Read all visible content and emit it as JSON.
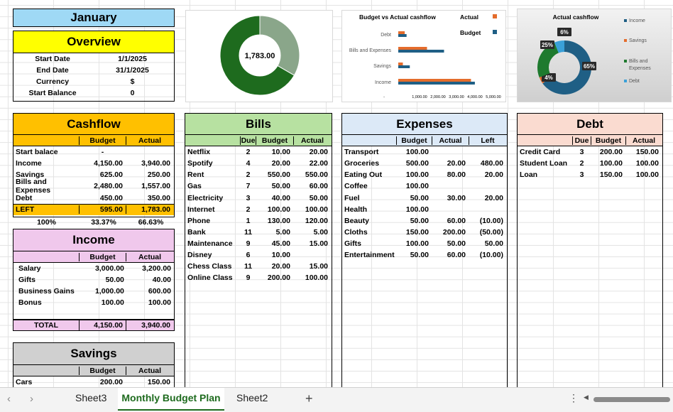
{
  "month": "January",
  "overview": {
    "title": "Overview",
    "rows": [
      [
        "Start Date",
        "1/1/2025"
      ],
      [
        "End Date",
        "31/1/2025"
      ],
      [
        "Currency",
        "$"
      ],
      [
        "Start Balance",
        "0"
      ]
    ]
  },
  "cashflow": {
    "title": "Cashflow",
    "budget": "Budget",
    "actual": "Actual",
    "rows": [
      [
        "Start balace",
        "-",
        ""
      ],
      [
        "Income",
        "4,150.00",
        "3,940.00"
      ],
      [
        "Savings",
        "625.00",
        "250.00"
      ],
      [
        "Bills and Expenses",
        "2,480.00",
        "1,557.00"
      ],
      [
        "Debt",
        "450.00",
        "350.00"
      ]
    ],
    "left": [
      "LEFT",
      "595.00",
      "1,783.00"
    ],
    "pct": [
      "100%",
      "33.37%",
      "66.63%"
    ]
  },
  "income": {
    "title": "Income",
    "budget": "Budget",
    "actual": "Actual",
    "rows": [
      [
        "Salary",
        "3,000.00",
        "3,200.00"
      ],
      [
        "Gifts",
        "50.00",
        "40.00"
      ],
      [
        "Business Gains",
        "1,000.00",
        "600.00"
      ],
      [
        "Bonus",
        "100.00",
        "100.00"
      ]
    ],
    "total": [
      "TOTAL",
      "4,150.00",
      "3,940.00"
    ]
  },
  "savings": {
    "title": "Savings",
    "budget": "Budget",
    "actual": "Actual",
    "rows": [
      [
        "Cars",
        "200.00",
        "150.00"
      ]
    ]
  },
  "bills": {
    "title": "Bills",
    "due": "Due",
    "budget": "Budget",
    "actual": "Actual",
    "rows": [
      [
        "Netflix",
        "2",
        "10.00",
        "20.00"
      ],
      [
        "Spotify",
        "4",
        "20.00",
        "22.00"
      ],
      [
        "Rent",
        "2",
        "550.00",
        "550.00"
      ],
      [
        "Gas",
        "7",
        "50.00",
        "60.00"
      ],
      [
        "Electricity",
        "3",
        "40.00",
        "50.00"
      ],
      [
        "Internet",
        "2",
        "100.00",
        "100.00"
      ],
      [
        "Phone",
        "1",
        "130.00",
        "120.00"
      ],
      [
        "Bank",
        "11",
        "5.00",
        "5.00"
      ],
      [
        "Maintenance",
        "9",
        "45.00",
        "15.00"
      ],
      [
        "Disney",
        "6",
        "10.00",
        ""
      ],
      [
        "Chess Class",
        "11",
        "20.00",
        "15.00"
      ],
      [
        "Online Class",
        "9",
        "200.00",
        "100.00"
      ]
    ]
  },
  "expenses": {
    "title": "Expenses",
    "budget": "Budget",
    "actual": "Actual",
    "left": "Left",
    "rows": [
      [
        "Transport",
        "100.00",
        "",
        ""
      ],
      [
        "Groceries",
        "500.00",
        "20.00",
        "480.00"
      ],
      [
        "Eating Out",
        "100.00",
        "80.00",
        "20.00"
      ],
      [
        "Coffee",
        "100.00",
        "",
        ""
      ],
      [
        "Fuel",
        "50.00",
        "30.00",
        "20.00"
      ],
      [
        "Health",
        "100.00",
        "",
        ""
      ],
      [
        "Beauty",
        "50.00",
        "60.00",
        "(10.00)"
      ],
      [
        "Cloths",
        "150.00",
        "200.00",
        "(50.00)"
      ],
      [
        "Gifts",
        "100.00",
        "50.00",
        "50.00"
      ],
      [
        "Entertainment",
        "50.00",
        "60.00",
        "(10.00)"
      ]
    ]
  },
  "debt": {
    "title": "Debt",
    "due": "Due",
    "budget": "Budget",
    "actual": "Actual",
    "rows": [
      [
        "Credit Card",
        "3",
        "200.00",
        "150.00"
      ],
      [
        "Student Loan",
        "2",
        "100.00",
        "100.00"
      ],
      [
        "Loan",
        "3",
        "150.00",
        "100.00"
      ]
    ]
  },
  "chart_data": [
    {
      "type": "pie",
      "center_label": "1,783.00",
      "slices": [
        {
          "label": "33.37%",
          "value": 33.37,
          "color": "#8aa68a"
        },
        {
          "label": "66.63%",
          "value": 66.63,
          "color": "#1e6b1e"
        }
      ]
    },
    {
      "type": "bar",
      "title": "Budget vs Actual cashflow",
      "categories": [
        "Debt",
        "Bills and Expenses",
        "Savings",
        "Income"
      ],
      "series": [
        {
          "name": "Actual",
          "values": [
            350,
            1557,
            250,
            3940
          ],
          "color": "#e46c2c"
        },
        {
          "name": "Budget",
          "values": [
            450,
            2480,
            625,
            4150
          ],
          "color": "#1f5f85"
        }
      ],
      "tick_labels": [
        "-",
        "1,000.00",
        "2,000.00",
        "3,000.00",
        "4,000.00",
        "5,000.00"
      ],
      "xlim": [
        0,
        5000
      ]
    },
    {
      "type": "pie",
      "title": "Actual cashflow",
      "legend": [
        "Income",
        "Savings",
        "Bills and Expenses",
        "Debt"
      ],
      "slices": [
        {
          "label": "65%",
          "value": 65,
          "color": "#1f5f85"
        },
        {
          "label": "4%",
          "value": 4,
          "color": "#e46c2c"
        },
        {
          "label": "25%",
          "value": 25,
          "color": "#1e7a2e"
        },
        {
          "label": "6%",
          "value": 6,
          "color": "#3aa0d8"
        }
      ]
    }
  ],
  "sheet_tabs": [
    "Sheet3",
    "Monthly Budget Plan",
    "Sheet2"
  ],
  "add_sheet": "+"
}
